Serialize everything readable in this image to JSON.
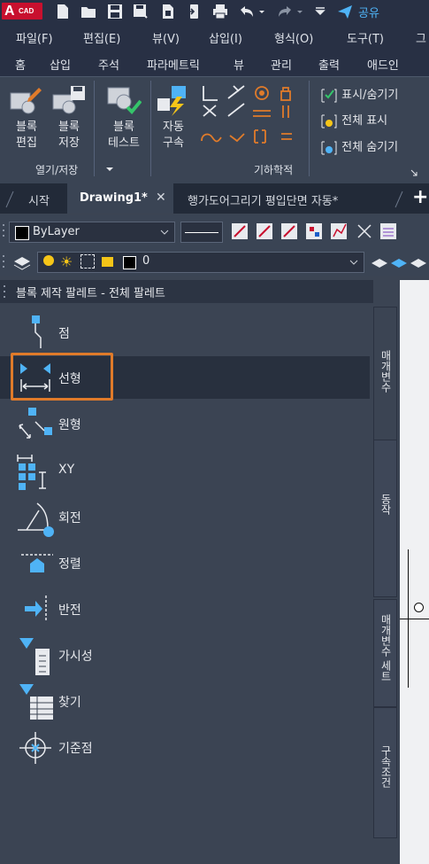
{
  "app": {
    "logo_letter": "A",
    "logo_text": "CAD",
    "share_label": "공유"
  },
  "menubar": [
    "파일(F)",
    "편집(E)",
    "뷰(V)",
    "삽입(I)",
    "형식(O)",
    "도구(T)",
    "그"
  ],
  "ribbon_tabs": [
    "홈",
    "삽입",
    "주석",
    "파라메트릭",
    "뷰",
    "관리",
    "출력",
    "애드인"
  ],
  "ribbon": {
    "block_edit": [
      "블록",
      "편집"
    ],
    "block_save": [
      "블록",
      "저장"
    ],
    "block_test": [
      "블록",
      "테스트"
    ],
    "auto_constrain": [
      "자동",
      "구속"
    ],
    "panel_open_save": "열기/저장",
    "panel_geometric": "기하학적",
    "show_hide": "표시/숨기기",
    "show_all": "전체 표시",
    "hide_all": "전체 숨기기"
  },
  "doc_tabs": [
    "시작",
    "Drawing1*",
    "행가도어그리기 평입단면 자동*"
  ],
  "properties": {
    "color_value": "ByLayer",
    "layer_value": "0"
  },
  "palette": {
    "title": "블록 제작 팔레트 - 전체 팔레트",
    "items": [
      "점",
      "선형",
      "원형",
      "XY",
      "회전",
      "정렬",
      "반전",
      "가시성",
      "찾기",
      "기준점"
    ],
    "side_tabs": [
      "매개변수",
      "동작",
      "매개변수 세트",
      "구속조건"
    ]
  },
  "colors": {
    "accent": "#4fb3f6",
    "highlight": "#e07b2a",
    "brand": "#c8102e"
  }
}
